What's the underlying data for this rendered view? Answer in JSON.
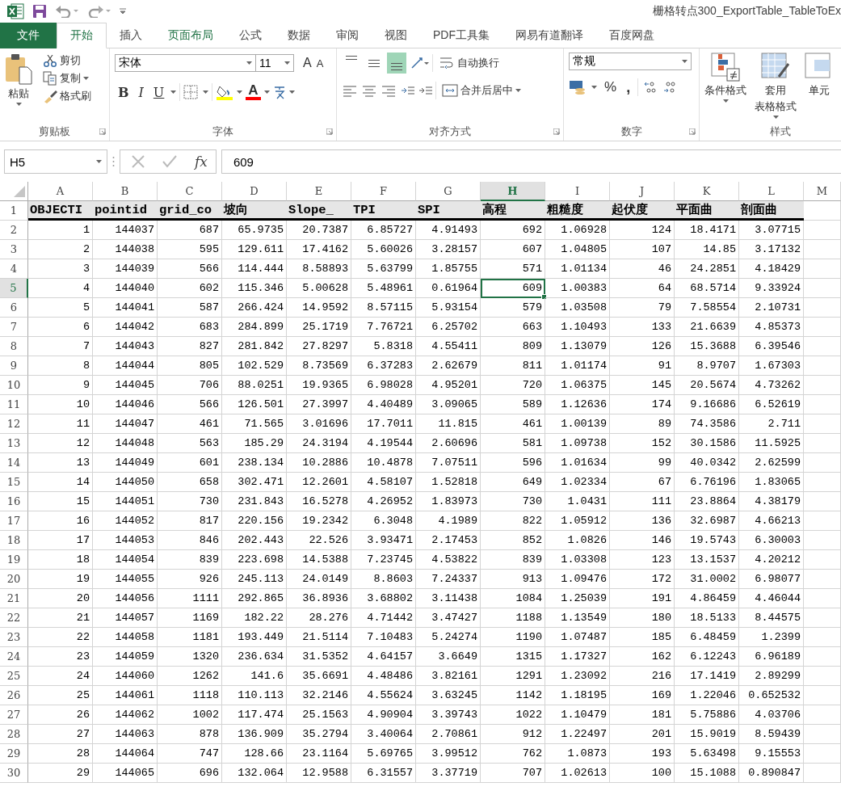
{
  "window": {
    "title": "栅格转点300_ExportTable_TableToEx"
  },
  "tabs": [
    {
      "label": "文件",
      "kind": "file",
      "selected": false,
      "highlighted": false
    },
    {
      "label": "开始",
      "kind": "tab",
      "selected": true,
      "highlighted": false
    },
    {
      "label": "插入",
      "kind": "tab",
      "selected": false,
      "highlighted": false
    },
    {
      "label": "页面布局",
      "kind": "tab",
      "selected": false,
      "highlighted": true
    },
    {
      "label": "公式",
      "kind": "tab",
      "selected": false,
      "highlighted": false
    },
    {
      "label": "数据",
      "kind": "tab",
      "selected": false,
      "highlighted": false
    },
    {
      "label": "审阅",
      "kind": "tab",
      "selected": false,
      "highlighted": false
    },
    {
      "label": "视图",
      "kind": "tab",
      "selected": false,
      "highlighted": false
    },
    {
      "label": "PDF工具集",
      "kind": "tab",
      "selected": false,
      "highlighted": false
    },
    {
      "label": "网易有道翻译",
      "kind": "tab",
      "selected": false,
      "highlighted": false
    },
    {
      "label": "百度网盘",
      "kind": "tab",
      "selected": false,
      "highlighted": false
    }
  ],
  "ribbon": {
    "groups": [
      {
        "kind": "clipboard",
        "label": "剪贴板",
        "paste": "粘贴",
        "items": [
          "剪切",
          "复制",
          "格式刷"
        ]
      },
      {
        "kind": "font",
        "label": "字体",
        "font_name": "宋体",
        "font_size": "11",
        "grow": "A",
        "shrink": "A",
        "bold": "B",
        "italic": "I",
        "underline": "U",
        "font_color": "A"
      },
      {
        "kind": "alignment",
        "label": "对齐方式",
        "wrap": "自动换行",
        "merge": "合并后居中",
        "vertical_align": [
          {
            "selected": false
          },
          {
            "selected": false
          },
          {
            "selected": true
          }
        ]
      },
      {
        "kind": "number",
        "label": "数字",
        "format": "常规",
        "percent": "%",
        "comma": ","
      },
      {
        "kind": "styles",
        "label": "样式",
        "items": [
          {
            "lines": [
              "条件格式"
            ]
          },
          {
            "lines": [
              "套用",
              "表格格式"
            ]
          },
          {
            "lines": [
              "单元"
            ]
          }
        ]
      }
    ]
  },
  "formula_bar": {
    "name_box": "H5",
    "fx": "fx",
    "value": "609"
  },
  "columns": [
    {
      "label": "A",
      "selected": false
    },
    {
      "label": "B",
      "selected": false
    },
    {
      "label": "C",
      "selected": false
    },
    {
      "label": "D",
      "selected": false
    },
    {
      "label": "E",
      "selected": false
    },
    {
      "label": "F",
      "selected": false
    },
    {
      "label": "G",
      "selected": false
    },
    {
      "label": "H",
      "selected": true
    },
    {
      "label": "I",
      "selected": false
    },
    {
      "label": "J",
      "selected": false
    },
    {
      "label": "K",
      "selected": false
    },
    {
      "label": "L",
      "selected": false
    },
    {
      "label": "M",
      "selected": false
    }
  ],
  "rows": [
    {
      "number": "1",
      "kind": "header",
      "selected": false,
      "cells": [
        "OBJECTI",
        "pointid",
        "grid_co",
        "坡向",
        "Slope_",
        "TPI",
        "SPI",
        "高程",
        "粗糙度",
        "起伏度",
        "平面曲",
        "剖面曲"
      ]
    },
    {
      "number": "2",
      "kind": "data",
      "selected": false,
      "cells": [
        "1",
        "144037",
        "687",
        "65.9735",
        "20.7387",
        "6.85727",
        "4.91493",
        "692",
        "1.06928",
        "124",
        "18.4171",
        "3.07715"
      ]
    },
    {
      "number": "3",
      "kind": "data",
      "selected": false,
      "cells": [
        "2",
        "144038",
        "595",
        "129.611",
        "17.4162",
        "5.60026",
        "3.28157",
        "607",
        "1.04805",
        "107",
        "14.85",
        "3.17132"
      ]
    },
    {
      "number": "4",
      "kind": "data",
      "selected": false,
      "cells": [
        "3",
        "144039",
        "566",
        "114.444",
        "8.58893",
        "5.63799",
        "1.85755",
        "571",
        "1.01134",
        "46",
        "24.2851",
        "4.18429"
      ]
    },
    {
      "number": "5",
      "kind": "data",
      "selected": true,
      "cells": [
        "4",
        "144040",
        "602",
        "115.346",
        "5.00628",
        "5.48961",
        "0.61964",
        "609",
        "1.00383",
        "64",
        "68.5714",
        "9.33924"
      ]
    },
    {
      "number": "6",
      "kind": "data",
      "selected": false,
      "cells": [
        "5",
        "144041",
        "587",
        "266.424",
        "14.9592",
        "8.57115",
        "5.93154",
        "579",
        "1.03508",
        "79",
        "7.58554",
        "2.10731"
      ]
    },
    {
      "number": "7",
      "kind": "data",
      "selected": false,
      "cells": [
        "6",
        "144042",
        "683",
        "284.899",
        "25.1719",
        "7.76721",
        "6.25702",
        "663",
        "1.10493",
        "133",
        "21.6639",
        "4.85373"
      ]
    },
    {
      "number": "8",
      "kind": "data",
      "selected": false,
      "cells": [
        "7",
        "144043",
        "827",
        "281.842",
        "27.8297",
        "5.8318",
        "4.55411",
        "809",
        "1.13079",
        "126",
        "15.3688",
        "6.39546"
      ]
    },
    {
      "number": "9",
      "kind": "data",
      "selected": false,
      "cells": [
        "8",
        "144044",
        "805",
        "102.529",
        "8.73569",
        "6.37283",
        "2.62679",
        "811",
        "1.01174",
        "91",
        "8.9707",
        "1.67303"
      ]
    },
    {
      "number": "10",
      "kind": "data",
      "selected": false,
      "cells": [
        "9",
        "144045",
        "706",
        "88.0251",
        "19.9365",
        "6.98028",
        "4.95201",
        "720",
        "1.06375",
        "145",
        "20.5674",
        "4.73262"
      ]
    },
    {
      "number": "11",
      "kind": "data",
      "selected": false,
      "cells": [
        "10",
        "144046",
        "566",
        "126.501",
        "27.3997",
        "4.40489",
        "3.09065",
        "589",
        "1.12636",
        "174",
        "9.16686",
        "6.52619"
      ]
    },
    {
      "number": "12",
      "kind": "data",
      "selected": false,
      "cells": [
        "11",
        "144047",
        "461",
        "71.565",
        "3.01696",
        "17.7011",
        "11.815",
        "461",
        "1.00139",
        "89",
        "74.3586",
        "2.711"
      ]
    },
    {
      "number": "13",
      "kind": "data",
      "selected": false,
      "cells": [
        "12",
        "144048",
        "563",
        "185.29",
        "24.3194",
        "4.19544",
        "2.60696",
        "581",
        "1.09738",
        "152",
        "30.1586",
        "11.5925"
      ]
    },
    {
      "number": "14",
      "kind": "data",
      "selected": false,
      "cells": [
        "13",
        "144049",
        "601",
        "238.134",
        "10.2886",
        "10.4878",
        "7.07511",
        "596",
        "1.01634",
        "99",
        "40.0342",
        "2.62599"
      ]
    },
    {
      "number": "15",
      "kind": "data",
      "selected": false,
      "cells": [
        "14",
        "144050",
        "658",
        "302.471",
        "12.2601",
        "4.58107",
        "1.52818",
        "649",
        "1.02334",
        "67",
        "6.76196",
        "1.83065"
      ]
    },
    {
      "number": "16",
      "kind": "data",
      "selected": false,
      "cells": [
        "15",
        "144051",
        "730",
        "231.843",
        "16.5278",
        "4.26952",
        "1.83973",
        "730",
        "1.0431",
        "111",
        "23.8864",
        "4.38179"
      ]
    },
    {
      "number": "17",
      "kind": "data",
      "selected": false,
      "cells": [
        "16",
        "144052",
        "817",
        "220.156",
        "19.2342",
        "6.3048",
        "4.1989",
        "822",
        "1.05912",
        "136",
        "32.6987",
        "4.66213"
      ]
    },
    {
      "number": "18",
      "kind": "data",
      "selected": false,
      "cells": [
        "17",
        "144053",
        "846",
        "202.443",
        "22.526",
        "3.93471",
        "2.17453",
        "852",
        "1.0826",
        "146",
        "19.5743",
        "6.30003"
      ]
    },
    {
      "number": "19",
      "kind": "data",
      "selected": false,
      "cells": [
        "18",
        "144054",
        "839",
        "223.698",
        "14.5388",
        "7.23745",
        "4.53822",
        "839",
        "1.03308",
        "123",
        "13.1537",
        "4.20212"
      ]
    },
    {
      "number": "20",
      "kind": "data",
      "selected": false,
      "cells": [
        "19",
        "144055",
        "926",
        "245.113",
        "24.0149",
        "8.8603",
        "7.24337",
        "913",
        "1.09476",
        "172",
        "31.0002",
        "6.98077"
      ]
    },
    {
      "number": "21",
      "kind": "data",
      "selected": false,
      "cells": [
        "20",
        "144056",
        "1111",
        "292.865",
        "36.8936",
        "3.68802",
        "3.11438",
        "1084",
        "1.25039",
        "191",
        "4.86459",
        "4.46044"
      ]
    },
    {
      "number": "22",
      "kind": "data",
      "selected": false,
      "cells": [
        "21",
        "144057",
        "1169",
        "182.22",
        "28.276",
        "4.71442",
        "3.47427",
        "1188",
        "1.13549",
        "180",
        "18.5133",
        "8.44575"
      ]
    },
    {
      "number": "23",
      "kind": "data",
      "selected": false,
      "cells": [
        "22",
        "144058",
        "1181",
        "193.449",
        "21.5114",
        "7.10483",
        "5.24274",
        "1190",
        "1.07487",
        "185",
        "6.48459",
        "1.2399"
      ]
    },
    {
      "number": "24",
      "kind": "data",
      "selected": false,
      "cells": [
        "23",
        "144059",
        "1320",
        "236.634",
        "31.5352",
        "4.64157",
        "3.6649",
        "1315",
        "1.17327",
        "162",
        "6.12243",
        "6.96189"
      ]
    },
    {
      "number": "25",
      "kind": "data",
      "selected": false,
      "cells": [
        "24",
        "144060",
        "1262",
        "141.6",
        "35.6691",
        "4.48486",
        "3.82161",
        "1291",
        "1.23092",
        "216",
        "17.1419",
        "2.89299"
      ]
    },
    {
      "number": "26",
      "kind": "data",
      "selected": false,
      "cells": [
        "25",
        "144061",
        "1118",
        "110.113",
        "32.2146",
        "4.55624",
        "3.63245",
        "1142",
        "1.18195",
        "169",
        "1.22046",
        "0.652532"
      ]
    },
    {
      "number": "27",
      "kind": "data",
      "selected": false,
      "cells": [
        "26",
        "144062",
        "1002",
        "117.474",
        "25.1563",
        "4.90904",
        "3.39743",
        "1022",
        "1.10479",
        "181",
        "5.75886",
        "4.03706"
      ]
    },
    {
      "number": "28",
      "kind": "data",
      "selected": false,
      "cells": [
        "27",
        "144063",
        "878",
        "136.909",
        "35.2794",
        "3.40064",
        "2.70861",
        "912",
        "1.22497",
        "201",
        "15.9019",
        "8.59439"
      ]
    },
    {
      "number": "29",
      "kind": "data",
      "selected": false,
      "cells": [
        "28",
        "144064",
        "747",
        "128.66",
        "23.1164",
        "5.69765",
        "3.99512",
        "762",
        "1.0873",
        "193",
        "5.63498",
        "9.15553"
      ]
    },
    {
      "number": "30",
      "kind": "data",
      "selected": false,
      "cells": [
        "29",
        "144065",
        "696",
        "132.064",
        "12.9588",
        "6.31557",
        "3.37719",
        "707",
        "1.02613",
        "100",
        "15.1088",
        "0.890847"
      ]
    }
  ]
}
